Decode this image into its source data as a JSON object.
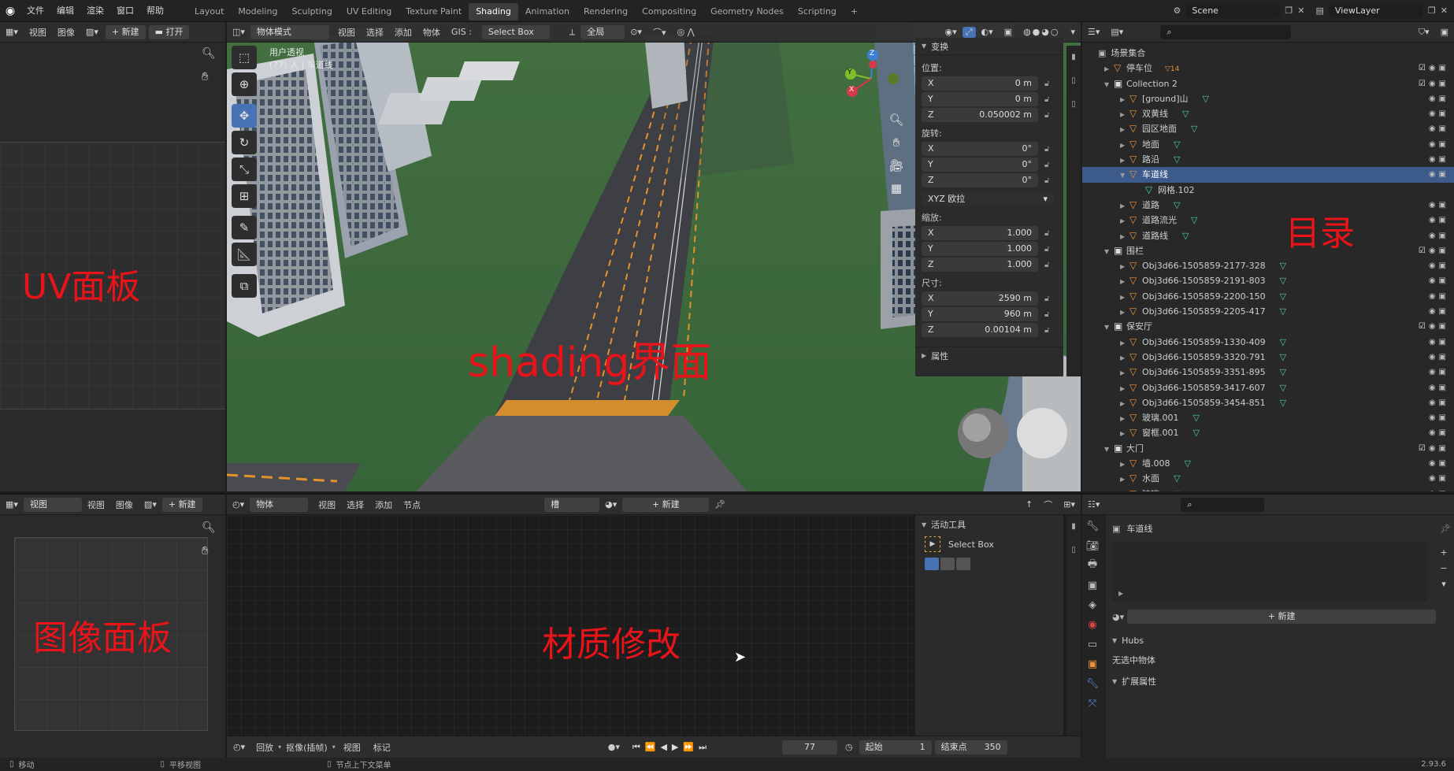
{
  "topbar": {
    "menus": [
      "文件",
      "编辑",
      "渲染",
      "窗口",
      "帮助"
    ],
    "tabs": [
      "Layout",
      "Modeling",
      "Sculpting",
      "UV Editing",
      "Texture Paint",
      "Shading",
      "Animation",
      "Rendering",
      "Compositing",
      "Geometry Nodes",
      "Scripting"
    ],
    "active_tab": "Shading",
    "add_tab": "+",
    "scene": "Scene",
    "viewlayer": "ViewLayer"
  },
  "uv_editor": {
    "header": {
      "view": "视图",
      "image": "图像",
      "new": "新建",
      "open": "打开"
    },
    "label": "UV面板"
  },
  "image_editor": {
    "header": {
      "mode": "视图",
      "view": "视图",
      "image": "图像",
      "new": "新建"
    },
    "label": "图像面板"
  },
  "viewport": {
    "header": {
      "mode": "物体模式",
      "view": "视图",
      "select": "选择",
      "add": "添加",
      "object": "物体",
      "gis": "GIS :",
      "select_box": "Select Box",
      "orient": "全局"
    },
    "overlay_line1": "用户透视",
    "overlay_line2": "(77) 人 | 车道线",
    "label": "shading界面",
    "gizmo": {
      "z": "Z",
      "y": "Y",
      "x": "X"
    }
  },
  "transform": {
    "title": "变换",
    "location_label": "位置:",
    "location": [
      {
        "axis": "X",
        "value": "0 m"
      },
      {
        "axis": "Y",
        "value": "0 m"
      },
      {
        "axis": "Z",
        "value": "0.050002 m"
      }
    ],
    "rotation_label": "旋转:",
    "rotation": [
      {
        "axis": "X",
        "value": "0°"
      },
      {
        "axis": "Y",
        "value": "0°"
      },
      {
        "axis": "Z",
        "value": "0°"
      }
    ],
    "rotation_mode": "XYZ 欧拉",
    "scale_label": "缩放:",
    "scale": [
      {
        "axis": "X",
        "value": "1.000"
      },
      {
        "axis": "Y",
        "value": "1.000"
      },
      {
        "axis": "Z",
        "value": "1.000"
      }
    ],
    "dimensions_label": "尺寸:",
    "dimensions": [
      {
        "axis": "X",
        "value": "2590 m"
      },
      {
        "axis": "Y",
        "value": "960 m"
      },
      {
        "axis": "Z",
        "value": "0.00104 m"
      }
    ],
    "properties": "属性"
  },
  "outliner": {
    "root": "场景集合",
    "label": "目录",
    "rows": [
      {
        "indent": 1,
        "name": "停车位",
        "kind": "obj",
        "badge": "14",
        "vis": true
      },
      {
        "indent": 1,
        "name": "Collection 2",
        "kind": "coll",
        "vis": true,
        "open": true
      },
      {
        "indent": 2,
        "name": "[ground]山",
        "kind": "obj",
        "mesh": true
      },
      {
        "indent": 2,
        "name": "双黄线",
        "kind": "obj",
        "mesh": true
      },
      {
        "indent": 2,
        "name": "园区地面",
        "kind": "obj",
        "mesh": true
      },
      {
        "indent": 2,
        "name": "地面",
        "kind": "obj",
        "mesh": true
      },
      {
        "indent": 2,
        "name": "路沿",
        "kind": "obj",
        "mesh": true
      },
      {
        "indent": 2,
        "name": "车道线",
        "kind": "obj",
        "sel": true,
        "open": true
      },
      {
        "indent": 3,
        "name": "网格.102",
        "kind": "mesh"
      },
      {
        "indent": 2,
        "name": "道路",
        "kind": "obj",
        "mesh": true
      },
      {
        "indent": 2,
        "name": "道路流光",
        "kind": "obj",
        "mesh": true
      },
      {
        "indent": 2,
        "name": "道路线",
        "kind": "obj",
        "mesh": true
      },
      {
        "indent": 1,
        "name": "围栏",
        "kind": "coll",
        "vis": true,
        "open": true
      },
      {
        "indent": 2,
        "name": "Obj3d66-1505859-2177-328",
        "kind": "obj",
        "mesh": true
      },
      {
        "indent": 2,
        "name": "Obj3d66-1505859-2191-803",
        "kind": "obj",
        "mesh": true
      },
      {
        "indent": 2,
        "name": "Obj3d66-1505859-2200-150",
        "kind": "obj",
        "mesh": true
      },
      {
        "indent": 2,
        "name": "Obj3d66-1505859-2205-417",
        "kind": "obj",
        "mesh": true
      },
      {
        "indent": 1,
        "name": "保安厅",
        "kind": "coll",
        "vis": true,
        "open": true
      },
      {
        "indent": 2,
        "name": "Obj3d66-1505859-1330-409",
        "kind": "obj",
        "mesh": true
      },
      {
        "indent": 2,
        "name": "Obj3d66-1505859-3320-791",
        "kind": "obj",
        "mesh": true
      },
      {
        "indent": 2,
        "name": "Obj3d66-1505859-3351-895",
        "kind": "obj",
        "mesh": true
      },
      {
        "indent": 2,
        "name": "Obj3d66-1505859-3417-607",
        "kind": "obj",
        "mesh": true
      },
      {
        "indent": 2,
        "name": "Obj3d66-1505859-3454-851",
        "kind": "obj",
        "mesh": true
      },
      {
        "indent": 2,
        "name": "玻璃.001",
        "kind": "obj",
        "mesh": true
      },
      {
        "indent": 2,
        "name": "窗框.001",
        "kind": "obj",
        "mesh": true
      },
      {
        "indent": 1,
        "name": "大门",
        "kind": "coll",
        "vis": true,
        "open": true
      },
      {
        "indent": 2,
        "name": "墙.008",
        "kind": "obj",
        "mesh": true
      },
      {
        "indent": 2,
        "name": "水面",
        "kind": "obj",
        "mesh": true
      },
      {
        "indent": 2,
        "name": "玻璃",
        "kind": "obj",
        "mesh": true
      }
    ]
  },
  "node_editor": {
    "header": {
      "mode": "物体",
      "view": "视图",
      "select": "选择",
      "add": "添加",
      "node": "节点",
      "slot": "槽",
      "new": "新建"
    },
    "label": "材质修改",
    "tool_title": "活动工具",
    "tool_name": "Select Box"
  },
  "properties": {
    "object_name": "车道线",
    "new": "新建",
    "hubs": "Hubs",
    "no_selection": "无选中物体",
    "ext": "扩展属性"
  },
  "timeline": {
    "playback": "回放",
    "keying": "抠像(插帧)",
    "view": "视图",
    "marker": "标记",
    "frame": "77",
    "start_label": "起始",
    "start": "1",
    "end_label": "结束点",
    "end": "350"
  },
  "statusbar": {
    "move": "移动",
    "pan": "平移视图",
    "ctx": "节点上下文菜单",
    "version": "2.93.6"
  }
}
